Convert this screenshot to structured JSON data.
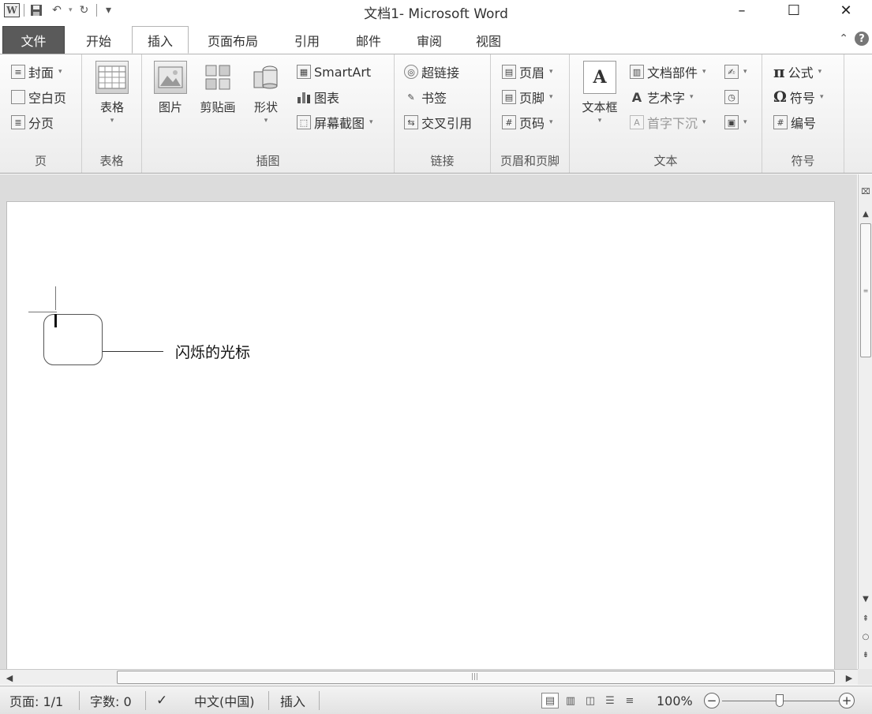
{
  "titlebar": {
    "title": "文档1- Microsoft Word",
    "icons": [
      "word-logo-icon",
      "save-icon",
      "undo-icon",
      "redo-icon",
      "customize-qat-icon"
    ],
    "controls": {
      "minimize": "–",
      "maximize": "☐",
      "close": "✕"
    }
  },
  "tabs": [
    {
      "label": "文件"
    },
    {
      "label": "开始"
    },
    {
      "label": "插入",
      "active": true
    },
    {
      "label": "页面布局"
    },
    {
      "label": "引用"
    },
    {
      "label": "邮件"
    },
    {
      "label": "审阅"
    },
    {
      "label": "视图"
    }
  ],
  "ribbon": {
    "pages": {
      "label": "页",
      "cover": "封面",
      "blank": "空白页",
      "break": "分页"
    },
    "tables": {
      "label": "表格",
      "table": "表格"
    },
    "illustrations": {
      "label": "插图",
      "picture": "图片",
      "clipart": "剪贴画",
      "shapes": "形状",
      "smartart": "SmartArt",
      "chart": "图表",
      "screenshot": "屏幕截图"
    },
    "links": {
      "label": "链接",
      "hyperlink": "超链接",
      "bookmark": "书签",
      "crossref": "交叉引用"
    },
    "header_footer": {
      "label": "页眉和页脚",
      "header": "页眉",
      "footer": "页脚",
      "page_number": "页码"
    },
    "text": {
      "label": "文本",
      "textbox": "文本框",
      "quick_parts": "文档部件",
      "wordart": "艺术字",
      "dropcap": "首字下沉"
    },
    "symbols": {
      "label": "符号",
      "equation": "公式",
      "symbol": "符号",
      "number": "编号"
    }
  },
  "document": {
    "annotation": "闪烁的光标"
  },
  "statusbar": {
    "page": "页面: 1/1",
    "words": "字数: 0",
    "language": "中文(中国)",
    "mode": "插入",
    "zoom": "100%",
    "zoom_level": 1.0
  }
}
